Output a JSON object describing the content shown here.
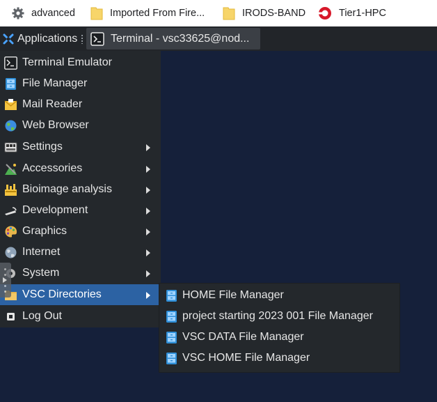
{
  "bookmarks": [
    {
      "label": "advanced",
      "icon": "gear-icon"
    },
    {
      "label": "Imported From Fire...",
      "icon": "folder-icon"
    },
    {
      "label": "IRODS-BAND",
      "icon": "folder-icon"
    },
    {
      "label": "Tier1-HPC",
      "icon": "tier1-logo-icon"
    }
  ],
  "panel": {
    "applications_label": "Applications",
    "task_label": "Terminal - vsc33625@nod..."
  },
  "menu": {
    "items": [
      {
        "label": "Terminal Emulator",
        "icon": "terminal-icon",
        "submenu": false
      },
      {
        "label": "File Manager",
        "icon": "file-manager-icon",
        "submenu": false
      },
      {
        "label": "Mail Reader",
        "icon": "mail-icon",
        "submenu": false
      },
      {
        "label": "Web Browser",
        "icon": "globe-icon",
        "submenu": false
      },
      {
        "label": "Settings",
        "icon": "settings-icon",
        "submenu": true
      },
      {
        "label": "Accessories",
        "icon": "accessories-icon",
        "submenu": true
      },
      {
        "label": "Bioimage analysis",
        "icon": "bioimage-icon",
        "submenu": true
      },
      {
        "label": "Development",
        "icon": "development-icon",
        "submenu": true
      },
      {
        "label": "Graphics",
        "icon": "palette-icon",
        "submenu": true
      },
      {
        "label": "Internet",
        "icon": "globe-icon",
        "submenu": true
      },
      {
        "label": "System",
        "icon": "gear-icon",
        "submenu": true
      },
      {
        "label": "VSC Directories",
        "icon": "folder-icon",
        "submenu": true,
        "active": true
      },
      {
        "label": "Log Out",
        "icon": "logout-icon",
        "submenu": false
      }
    ]
  },
  "submenu": {
    "items": [
      {
        "label": "HOME File Manager",
        "icon": "file-manager-icon"
      },
      {
        "label": "project starting 2023 001 File Manager",
        "icon": "file-manager-icon"
      },
      {
        "label": "VSC DATA File Manager",
        "icon": "file-manager-icon"
      },
      {
        "label": "VSC HOME File Manager",
        "icon": "file-manager-icon"
      }
    ]
  },
  "colors": {
    "panel_bg": "#222529",
    "menu_bg": "#24282c",
    "highlight": "#2c62a3",
    "desktop_bg": "#15203a"
  }
}
